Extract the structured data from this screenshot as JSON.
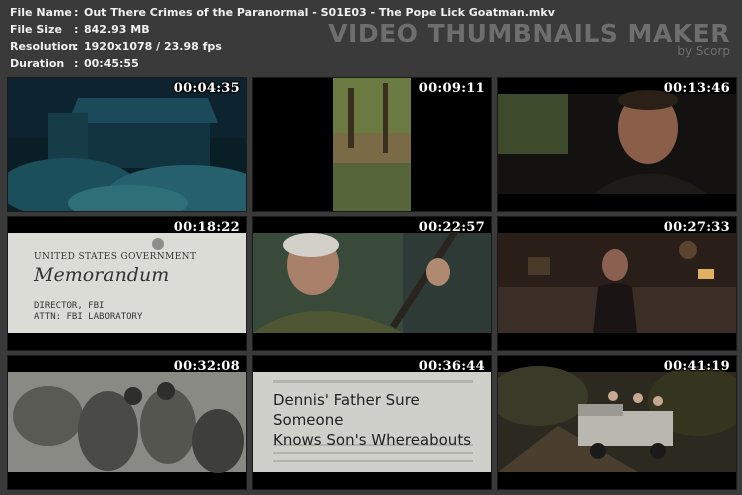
{
  "info": {
    "file_name_label": "File Name",
    "file_name": "Out There Crimes of the Paranormal - S01E03 - The Pope Lick Goatman.mkv",
    "file_size_label": "File Size",
    "file_size": "842.93 MB",
    "resolution_label": "Resolution",
    "resolution": "1920x1078 / 23.98 fps",
    "duration_label": "Duration",
    "duration": "00:45:55",
    "separator": ":"
  },
  "brand": {
    "name": "VIDEO THUMBNAILS MAKER",
    "by": "by Scorp"
  },
  "thumbnails": [
    {
      "timestamp": "00:04:35",
      "scene": "night-house"
    },
    {
      "timestamp": "00:09:11",
      "scene": "forest-creek"
    },
    {
      "timestamp": "00:13:46",
      "scene": "man-interview"
    },
    {
      "timestamp": "00:18:22",
      "scene": "memorandum",
      "lines": [
        "UNITED STATES GOVERNMENT",
        "Memorandum",
        "DIRECTOR, FBI",
        "ATTN:  FBI LABORATORY"
      ]
    },
    {
      "timestamp": "00:22:57",
      "scene": "banjo-player"
    },
    {
      "timestamp": "00:27:33",
      "scene": "woman-living-room"
    },
    {
      "timestamp": "00:32:08",
      "scene": "soldiers"
    },
    {
      "timestamp": "00:36:44",
      "scene": "newspaper",
      "lines": [
        "Dennis' Father Sure Someone",
        "Knows Son's Whereabouts"
      ]
    },
    {
      "timestamp": "00:41:19",
      "scene": "truck-woods"
    }
  ],
  "colors": {
    "background": "#3a3a3a",
    "info_text": "#f0f0f0",
    "brand_text": "#6e6e6e"
  }
}
